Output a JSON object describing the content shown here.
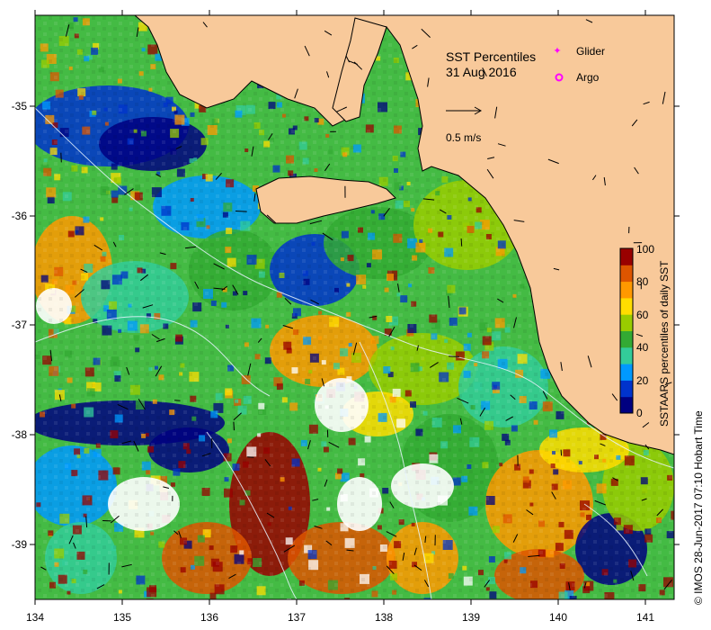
{
  "map": {
    "title": "SST Percentiles",
    "date": "31 Aug 2016",
    "x_ticks": [
      "134",
      "135",
      "136",
      "137",
      "138",
      "139",
      "140",
      "141"
    ],
    "y_ticks": [
      "-35",
      "-36",
      "-37",
      "-38",
      "-39"
    ],
    "legend": {
      "glider_label": "Glider",
      "argo_label": "Argo",
      "glider_color": "#ff00ff",
      "argo_color": "#ff00ff"
    },
    "scale_arrow_label": "0.5 m/s",
    "colorbar": {
      "label": "SSTAARS percentiles of daily SST",
      "ticks": [
        "100",
        "80",
        "60",
        "40",
        "20",
        "0"
      ],
      "colors": [
        "#000080",
        "#0033cc",
        "#0099ff",
        "#33cc99",
        "#33aa33",
        "#99cc00",
        "#ffdd00",
        "#ff9900",
        "#dd5500",
        "#990000"
      ]
    },
    "credit": "© IMOS 28-Jun-2017 07:10 Hobart Time",
    "land_color": "#f8c99a"
  }
}
